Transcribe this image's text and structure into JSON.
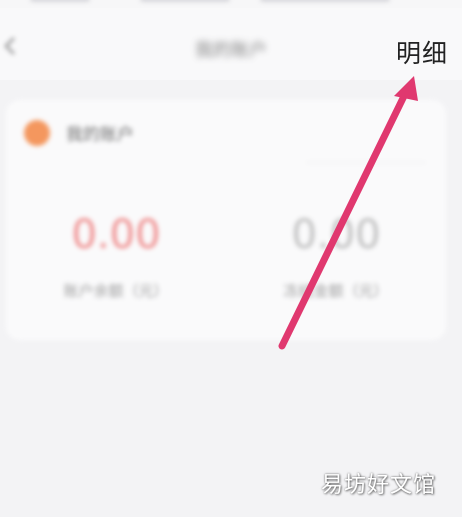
{
  "header": {
    "title": "我的账户",
    "detail_label": "明细"
  },
  "account": {
    "name": "我的账户",
    "dot_color": "#f59052",
    "balance_primary": "0.00",
    "balance_primary_label": "账户余额（元）",
    "balance_secondary": "0.00",
    "balance_secondary_label": "冻结金额（元）"
  },
  "annotation": {
    "arrow_color": "#e0386f",
    "arrow_target": "detail-link"
  },
  "watermark": {
    "text": "易坊好文馆"
  }
}
